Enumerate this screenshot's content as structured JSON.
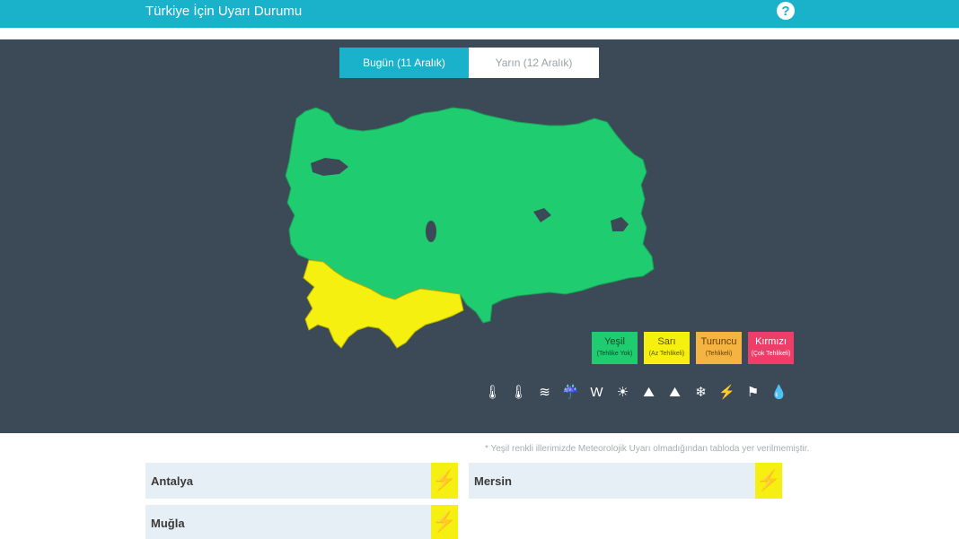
{
  "header": {
    "title": "Türkiye İçin Uyarı Durumu",
    "help_icon": "question-circle-icon",
    "help_glyph": "?"
  },
  "tabs": [
    {
      "label": "Bugün (11 Aralık)",
      "active": true
    },
    {
      "label": "Yarın (12 Aralık)",
      "active": false
    }
  ],
  "colors": {
    "header": "#1ab2cb",
    "panel": "#3b4a56",
    "green": "#20cc70",
    "yellow": "#f5f010",
    "orange": "#f5b342",
    "red": "#ee3d68"
  },
  "legend": [
    {
      "name": "Yeşil",
      "sub": "(Tehlike Yok)"
    },
    {
      "name": "Sarı",
      "sub": "(Az Tehlikeli)"
    },
    {
      "name": "Turuncu",
      "sub": "(Tehlikeli)"
    },
    {
      "name": "Kırmızı",
      "sub": "(Çok Tehlikeli)"
    }
  ],
  "warning_icons": [
    {
      "name": "low-temperature-icon",
      "glyph": "🌡"
    },
    {
      "name": "high-temperature-icon",
      "glyph": "🌡"
    },
    {
      "name": "fog-icon",
      "glyph": "≋"
    },
    {
      "name": "flood-icon",
      "glyph": "☔"
    },
    {
      "name": "wind-icon",
      "glyph": "W"
    },
    {
      "name": "dust-icon",
      "glyph": "☀"
    },
    {
      "name": "avalanche-icon",
      "glyph": "⛰"
    },
    {
      "name": "landslide-icon",
      "glyph": "⛰"
    },
    {
      "name": "snow-icon",
      "glyph": "❄"
    },
    {
      "name": "thunderstorm-icon",
      "glyph": "⚡"
    },
    {
      "name": "windsock-icon",
      "glyph": "⚑"
    },
    {
      "name": "rain-icon",
      "glyph": "💧"
    }
  ],
  "note": "* Yeşil renkli illerimizde Meteorolojik Uyarı olmadığından tabloda yer verilmemiştir.",
  "warnings": [
    {
      "province": "Antalya",
      "icon": "lightning-icon",
      "glyph": "⚡"
    },
    {
      "province": "Mersin",
      "icon": "lightning-icon",
      "glyph": "⚡"
    },
    {
      "province": "Muğla",
      "icon": "lightning-icon",
      "glyph": "⚡"
    }
  ]
}
